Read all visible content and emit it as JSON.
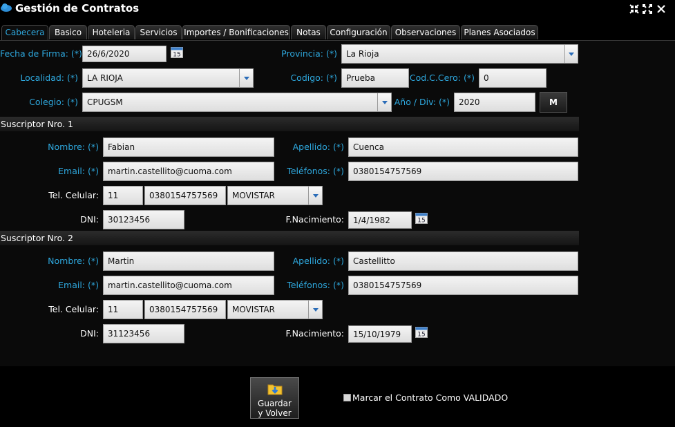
{
  "window": {
    "title": "Gestión de Contratos",
    "controls": [
      "shrink-icon",
      "expand-icon",
      "close-icon"
    ]
  },
  "tabs": [
    {
      "label": "Cabecera",
      "active": true
    },
    {
      "label": "Basico"
    },
    {
      "label": "Hoteleria"
    },
    {
      "label": "Servicios"
    },
    {
      "label": "Importes / Bonificaciones"
    },
    {
      "label": "Notas"
    },
    {
      "label": "Configuración"
    },
    {
      "label": "Observaciones"
    },
    {
      "label": "Planes Asociados"
    }
  ],
  "header": {
    "fecha_firma": {
      "label": "Fecha de Firma: (*)",
      "value": "26/6/2020"
    },
    "provincia": {
      "label": "Provincia: (*)",
      "value": "La Rioja"
    },
    "localidad": {
      "label": "Localidad: (*)",
      "value": "LA RIOJA"
    },
    "codigo": {
      "label": "Codigo: (*)",
      "value": "Prueba"
    },
    "cod_c_cero": {
      "label": "Cod.C.Cero: (*)",
      "value": "0"
    },
    "colegio": {
      "label": "Colegio: (*)",
      "value": "CPUGSM"
    },
    "anio_div": {
      "label": "Año / Div: (*)",
      "value": "2020"
    },
    "m_button": "M"
  },
  "subscribers": [
    {
      "section_title": "Suscriptor Nro. 1",
      "nombre_label": "Nombre: (*)",
      "nombre": "Fabian",
      "apellido_label": "Apellido: (*)",
      "apellido": "Cuenca",
      "email_label": "Email: (*)",
      "email": "martin.castellito@cuoma.com",
      "telefonos_label": "Teléfonos: (*)",
      "telefonos": "0380154757569",
      "celular_label": "Tel. Celular:",
      "cel_area": "11",
      "cel_numero": "0380154757569",
      "cel_compania": "MOVISTAR",
      "dni_label": "DNI:",
      "dni": "30123456",
      "nacimiento_label": "F.Nacimiento:",
      "nacimiento": "1/4/1982"
    },
    {
      "section_title": "Suscriptor Nro. 2",
      "nombre_label": "Nombre: (*)",
      "nombre": "Martin",
      "apellido_label": "Apellido: (*)",
      "apellido": "Castellitto",
      "email_label": "Email: (*)",
      "email": "martin.castellito@cuoma.com",
      "telefonos_label": "Teléfonos: (*)",
      "telefonos": "0380154757569",
      "celular_label": "Tel. Celular:",
      "cel_area": "11",
      "cel_numero": "0380154757569",
      "cel_compania": "MOVISTAR",
      "dni_label": "DNI:",
      "dni": "31123456",
      "nacimiento_label": "F.Nacimiento:",
      "nacimiento": "15/10/1979"
    }
  ],
  "footer": {
    "save_button_line1": "Guardar",
    "save_button_line2": "y Volver",
    "validate_checkbox_label": "Marcar el Contrato Como VALIDADO",
    "validate_checked": false
  },
  "colors": {
    "accent": "#2ea8de",
    "background": "#000000",
    "field": "#e8e8e8",
    "dropdown_arrow": "#2a6cb8"
  }
}
